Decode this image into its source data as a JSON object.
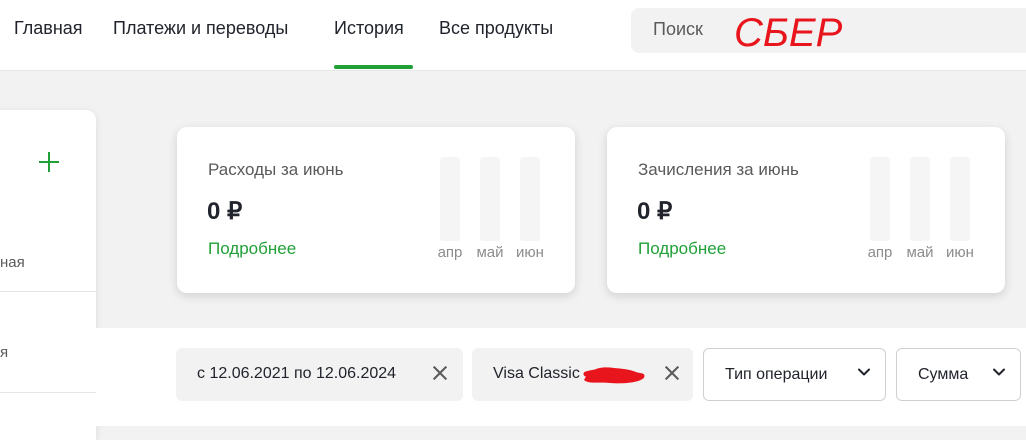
{
  "nav": {
    "items": [
      {
        "label": "Главная"
      },
      {
        "label": "Платежи и переводы"
      },
      {
        "label": "История"
      },
      {
        "label": "Все продукты"
      }
    ]
  },
  "search": {
    "placeholder": "Поиск"
  },
  "annotation": {
    "text": "СБЕР"
  },
  "left_panel": {
    "items": [
      {
        "label": "ная"
      },
      {
        "label": "я"
      }
    ]
  },
  "summary_cards": [
    {
      "title": "Расходы за июнь",
      "amount": "0 ₽",
      "link": "Подробнее",
      "months": [
        "апр",
        "май",
        "июн"
      ],
      "month_values": [
        0,
        0,
        0
      ]
    },
    {
      "title": "Зачисления за июнь",
      "amount": "0 ₽",
      "link": "Подробнее",
      "months": [
        "апр",
        "май",
        "июн"
      ],
      "month_values": [
        0,
        0,
        0
      ]
    }
  ],
  "filters": {
    "date_chip": "с 12.06.2021 по 12.06.2024",
    "card_chip": "Visa Classic",
    "operation_type": "Тип операции",
    "amount": "Сумма"
  },
  "colors": {
    "accent": "#21a038",
    "annotation": "#e8151c",
    "redaction": "#e8151c"
  }
}
